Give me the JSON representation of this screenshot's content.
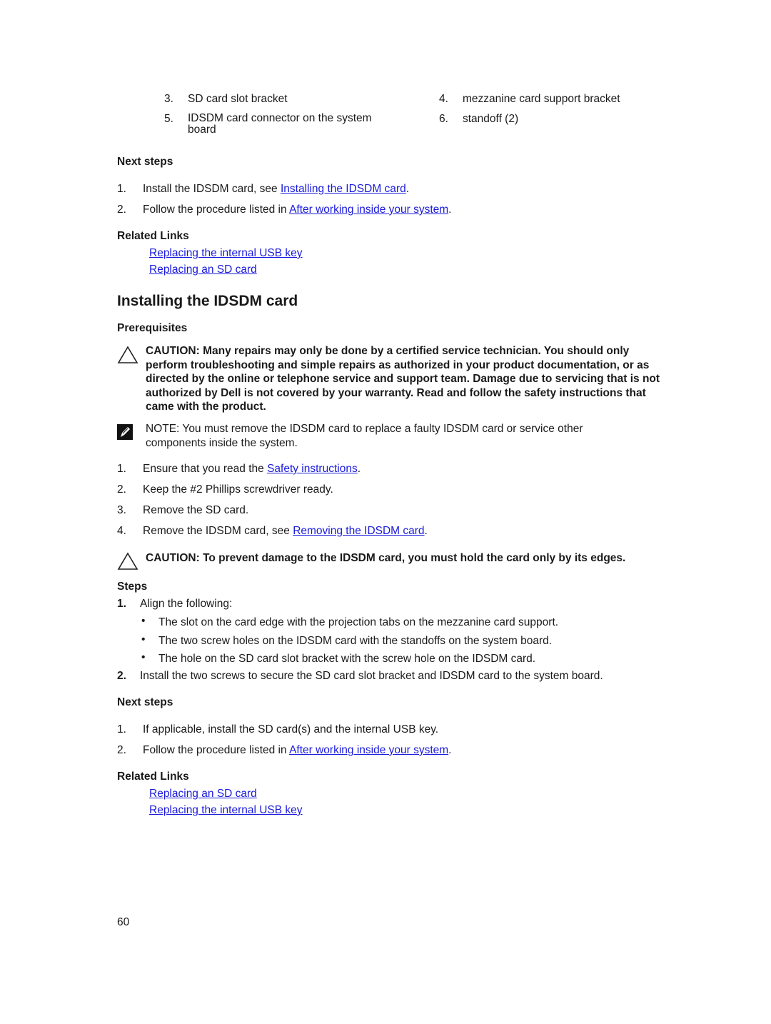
{
  "legend_items": [
    {
      "num": "3.",
      "label": "SD card slot bracket"
    },
    {
      "num": "4.",
      "label": "mezzanine card support bracket"
    },
    {
      "num": "5.",
      "label": "IDSDM card connector on the system board"
    },
    {
      "num": "6.",
      "label": "standoff (2)"
    }
  ],
  "next_steps_1": {
    "heading": "Next steps",
    "items": [
      {
        "num": "1.",
        "pre": "Install the IDSDM card, see ",
        "link": "Installing the IDSDM card",
        "post": "."
      },
      {
        "num": "2.",
        "pre": "Follow the procedure listed in ",
        "link": "After working inside your system",
        "post": "."
      }
    ]
  },
  "related_links_1": {
    "heading": "Related Links",
    "links": [
      "Replacing the internal USB key",
      "Replacing an SD card"
    ]
  },
  "section_title": "Installing the IDSDM card",
  "prerequisites": {
    "heading": "Prerequisites",
    "caution": "CAUTION: Many repairs may only be done by a certified service technician. You should only perform troubleshooting and simple repairs as authorized in your product documentation, or as directed by the online or telephone service and support team. Damage due to servicing that is not authorized by Dell is not covered by your warranty. Read and follow the safety instructions that came with the product.",
    "note_label": "NOTE:",
    "note_text": " You must remove the IDSDM card to replace a faulty IDSDM card or service other components inside the system.",
    "items": [
      {
        "num": "1.",
        "pre": "Ensure that you read the ",
        "link": "Safety instructions",
        "post": "."
      },
      {
        "num": "2.",
        "pre": "Keep the #2 Phillips screwdriver ready.",
        "link": "",
        "post": ""
      },
      {
        "num": "3.",
        "pre": "Remove the SD card.",
        "link": "",
        "post": ""
      },
      {
        "num": "4.",
        "pre": "Remove the IDSDM card, see ",
        "link": "Removing the IDSDM card",
        "post": "."
      }
    ],
    "caution2": "CAUTION: To prevent damage to the IDSDM card, you must hold the card only by its edges."
  },
  "steps": {
    "heading": "Steps",
    "step1_num": "1.",
    "step1": "Align the following:",
    "bullets": [
      "The slot on the card edge with the projection tabs on the mezzanine card support.",
      "The two screw holes on the IDSDM card with the standoffs on the system board.",
      "The hole on the SD card slot bracket with the screw hole on the IDSDM card."
    ],
    "step2_num": "2.",
    "step2": "Install the two screws to secure the SD card slot bracket and IDSDM card to the system board."
  },
  "next_steps_2": {
    "heading": "Next steps",
    "items": [
      {
        "num": "1.",
        "pre": "If applicable, install the SD card(s) and the internal USB key.",
        "link": "",
        "post": ""
      },
      {
        "num": "2.",
        "pre": "Follow the procedure listed in ",
        "link": "After working inside your system",
        "post": "."
      }
    ]
  },
  "related_links_2": {
    "heading": "Related Links",
    "links": [
      "Replacing an SD card",
      "Replacing the internal USB key"
    ]
  },
  "page_number": "60"
}
